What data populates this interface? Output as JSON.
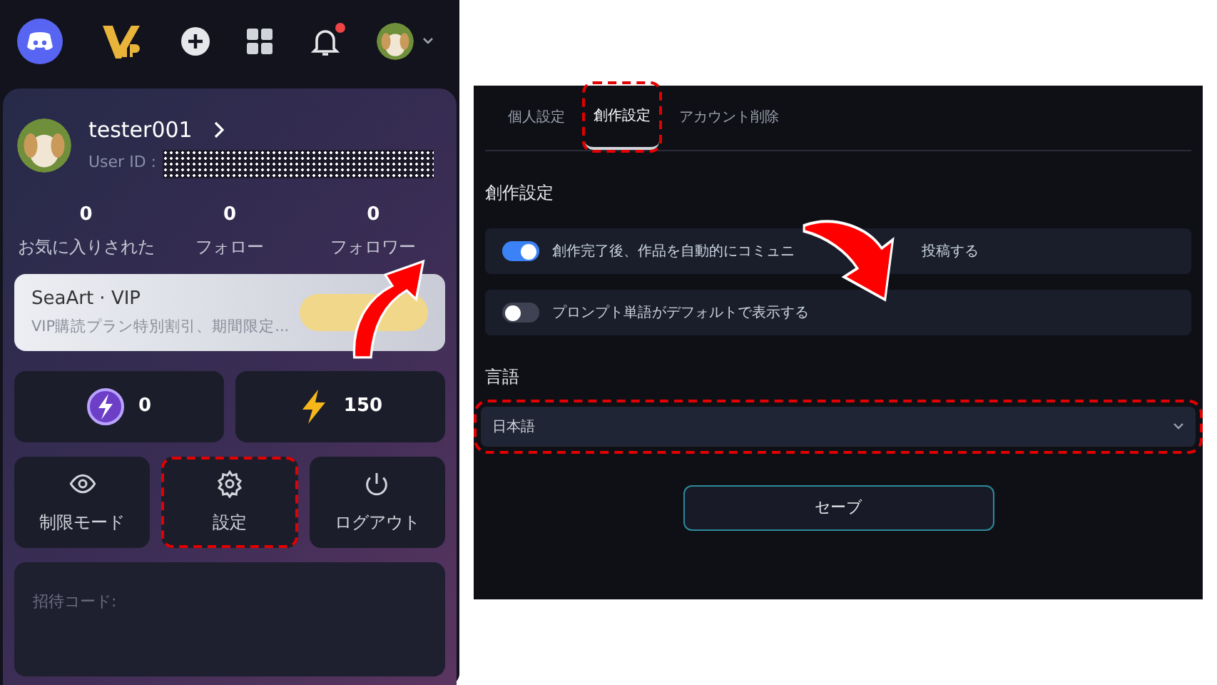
{
  "nav": {
    "notification_badge": true
  },
  "profile": {
    "username": "tester001",
    "user_id_label": "User ID :",
    "stats": [
      {
        "value": "0",
        "label": "お気に入りされた"
      },
      {
        "value": "0",
        "label": "フォロー"
      },
      {
        "value": "0",
        "label": "フォロワー"
      }
    ],
    "vip": {
      "title": "SeaArt · VIP",
      "subtitle": "VIP購読プラン特別割引、期間限定..."
    },
    "points": [
      {
        "kind": "gem",
        "value": "0"
      },
      {
        "kind": "bolt",
        "value": "150"
      }
    ],
    "actions": [
      {
        "kind": "eye",
        "label": "制限モード",
        "highlighted": false
      },
      {
        "kind": "gear",
        "label": "設定",
        "highlighted": true
      },
      {
        "kind": "power",
        "label": "ログアウト",
        "highlighted": false
      }
    ],
    "invite_label": "招待コード:"
  },
  "settings": {
    "tabs": [
      {
        "label": "個人設定",
        "selected": false,
        "highlighted": false
      },
      {
        "label": "創作設定",
        "selected": true,
        "highlighted": true
      },
      {
        "label": "アカウント削除",
        "selected": false,
        "highlighted": false
      }
    ],
    "section_title": "創作設定",
    "toggles": [
      {
        "on": true,
        "text_parts": [
          "創作完了後、作品を自動的にコミュニ",
          "投稿する"
        ]
      },
      {
        "on": false,
        "text_parts": [
          "プロンプト単語がデフォルトで表示する"
        ]
      }
    ],
    "language_label": "言語",
    "language": {
      "value": "日本語",
      "highlighted": true
    },
    "save": "セーブ"
  }
}
